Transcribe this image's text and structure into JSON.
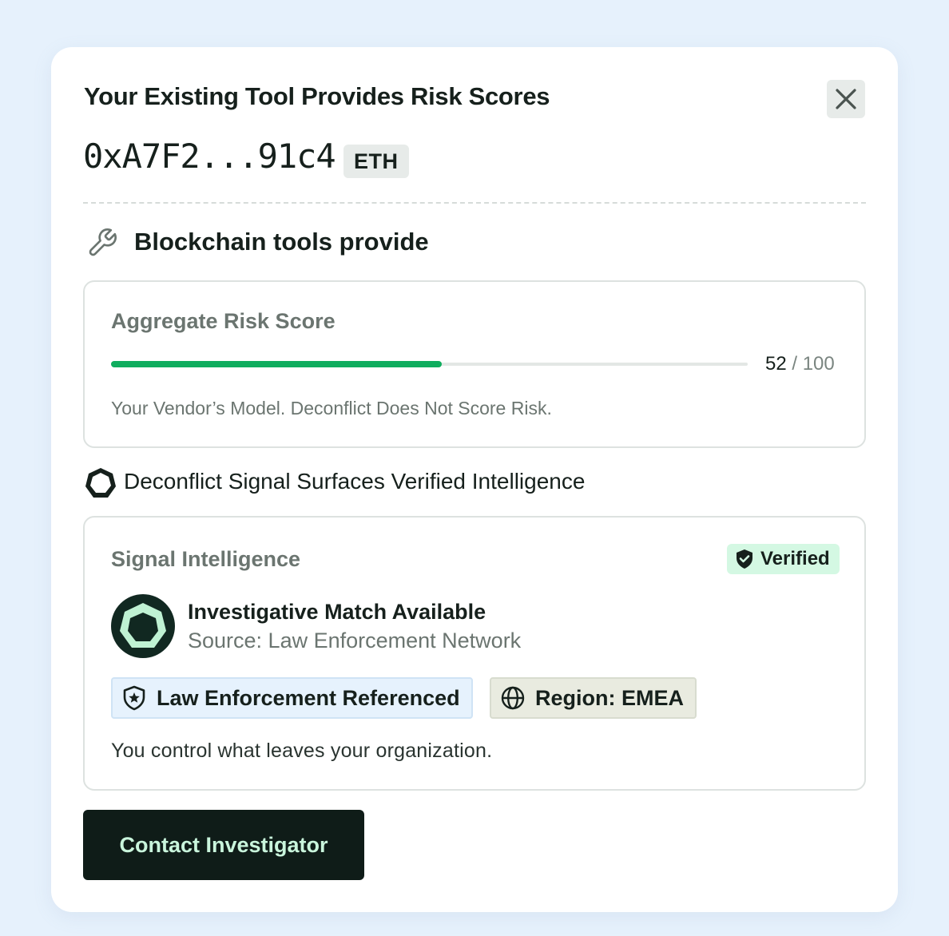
{
  "dialog": {
    "title": "Your Existing Tool Provides Risk Scores",
    "close_icon": "close-icon",
    "address": "0xA7F2...91c4",
    "chain": "ETH"
  },
  "tools_section": {
    "icon": "wrench-icon",
    "heading": "Blockchain tools provide"
  },
  "risk_score": {
    "label": "Aggregate Risk Score",
    "value": "52",
    "max": "/ 100",
    "fill_fraction": 0.52,
    "note": "Your Vendor’s Model. Deconflict Does Not Score Risk.",
    "bar_color": "#0fad5e"
  },
  "signal_section": {
    "icon": "deconflict-logo-icon",
    "heading": "Deconflict Signal Surfaces Verified Intelligence"
  },
  "signal_card": {
    "label": "Signal Intelligence",
    "verified_badge": "Verified",
    "verified_icon": "shield-check-icon",
    "match_title": "Investigative Match Available",
    "match_source": "Source: Law Enforcement Network",
    "tags": [
      {
        "icon": "badge-star-icon",
        "label": "Law Enforcement Referenced"
      },
      {
        "icon": "globe-icon",
        "label": "Region: EMEA"
      }
    ],
    "control_note": "You control what leaves your organization."
  },
  "actions": {
    "contact_label": "Contact Investigator"
  },
  "colors": {
    "background": "#e6f1fc",
    "accent_green": "#0fad5e",
    "cta_background": "#0f1c18",
    "cta_text": "#c9f5dc",
    "verified_background": "#d4f8e3"
  }
}
